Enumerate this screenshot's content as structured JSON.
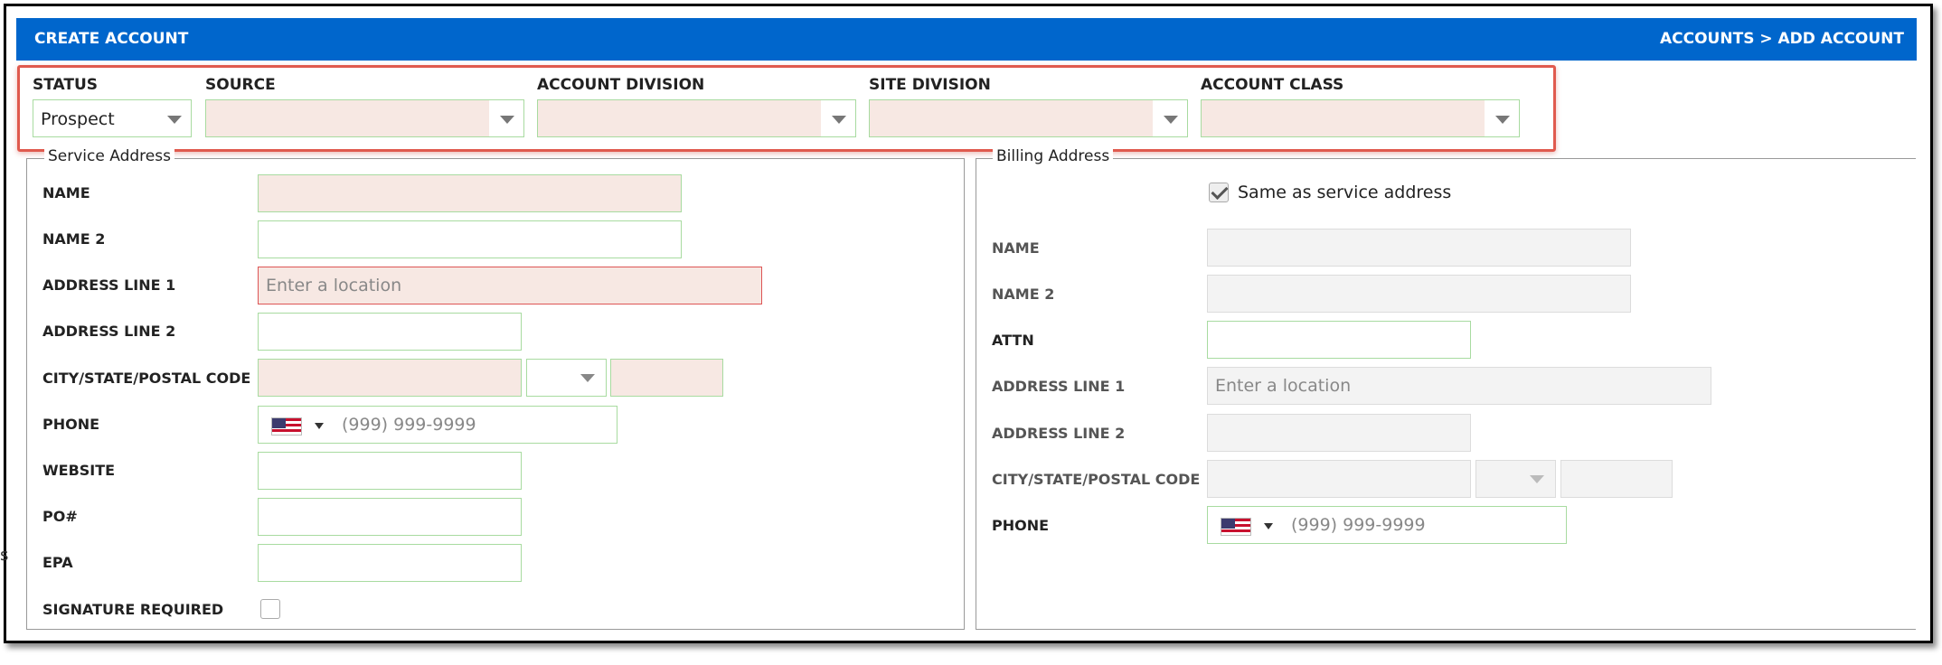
{
  "header": {
    "title": "CREATE ACCOUNT",
    "breadcrumb": "ACCOUNTS > ADD ACCOUNT",
    "color": "#0066cc"
  },
  "top_fields": {
    "status": {
      "label": "STATUS",
      "value": "Prospect"
    },
    "source": {
      "label": "SOURCE",
      "value": ""
    },
    "account_division": {
      "label": "ACCOUNT DIVISION",
      "value": ""
    },
    "site_division": {
      "label": "SITE DIVISION",
      "value": ""
    },
    "account_class": {
      "label": "ACCOUNT CLASS",
      "value": ""
    }
  },
  "service_address": {
    "legend": "Service Address",
    "labels": {
      "name": "NAME",
      "name2": "NAME 2",
      "address1": "ADDRESS LINE 1",
      "address2": "ADDRESS LINE 2",
      "city_state_zip": "CITY/STATE/POSTAL CODE",
      "phone": "PHONE",
      "website": "WEBSITE",
      "po": "PO#",
      "epa": "EPA",
      "signature": "SIGNATURE REQUIRED"
    },
    "address1_placeholder": "Enter a location",
    "phone_placeholder": "(999) 999-9999",
    "signature_required": false
  },
  "billing_address": {
    "legend": "Billing Address",
    "same_as_service_label": "Same as service address",
    "same_as_service": true,
    "labels": {
      "name": "NAME",
      "name2": "NAME 2",
      "attn": "ATTN",
      "address1": "ADDRESS LINE 1",
      "address2": "ADDRESS LINE 2",
      "city_state_zip": "CITY/STATE/POSTAL CODE",
      "phone": "PHONE"
    },
    "address1_placeholder": "Enter a location",
    "phone_placeholder": "(999) 999-9999"
  },
  "edge_text": "s"
}
